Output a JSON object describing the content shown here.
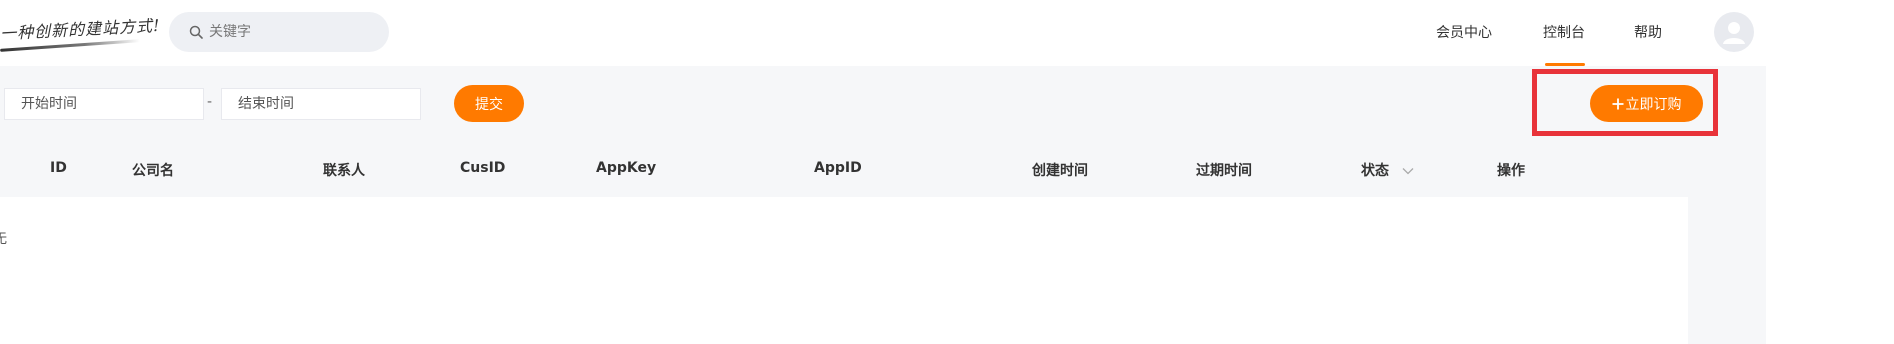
{
  "header": {
    "logo_text": "一种创新的建站方式!",
    "search": {
      "placeholder": "关键字"
    },
    "nav": [
      "会员中心",
      "控制台",
      "帮助"
    ],
    "active_nav": "控制台",
    "accent_color": "#ff7a00"
  },
  "filter": {
    "start_placeholder": "开始时间",
    "separator": "-",
    "end_placeholder": "结束时间",
    "submit_label": "提交",
    "order_label": "立即订购",
    "order_icon": "plus-icon",
    "highlight_color": "#e8333a"
  },
  "table": {
    "columns": [
      "ID",
      "公司名",
      "联系人",
      "CusID",
      "AppKey",
      "AppID",
      "创建时间",
      "过期时间",
      "状态",
      "操作"
    ],
    "sortable_column": "状态",
    "row_fragment": "无"
  }
}
